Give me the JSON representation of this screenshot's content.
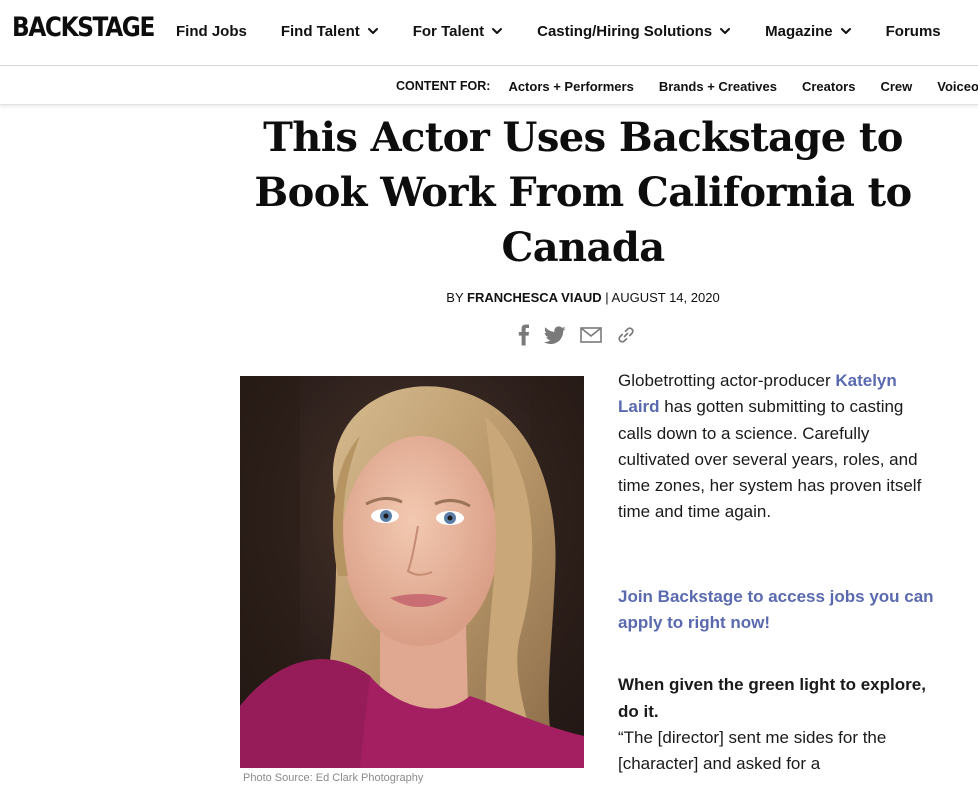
{
  "brand": {
    "logo": "BACKSTAGE"
  },
  "nav": {
    "items": [
      {
        "label": "Find Jobs",
        "dropdown": false
      },
      {
        "label": "Find Talent",
        "dropdown": true
      },
      {
        "label": "For Talent",
        "dropdown": true
      },
      {
        "label": "Casting/Hiring Solutions",
        "dropdown": true
      },
      {
        "label": "Magazine",
        "dropdown": true
      },
      {
        "label": "Forums",
        "dropdown": false
      }
    ]
  },
  "subnav": {
    "label": "CONTENT FOR:",
    "items": [
      "Actors + Performers",
      "Brands + Creatives",
      "Creators",
      "Crew",
      "Voiceo"
    ]
  },
  "article": {
    "headline_lines": [
      "This Actor Uses Backstage to",
      "Book Work From California to",
      "Canada"
    ],
    "byline_prefix": "BY",
    "author": "FRANCHESCA VIAUD",
    "separator": "|",
    "date": "AUGUST 14, 2020",
    "share_icons": [
      "facebook-icon",
      "twitter-icon",
      "email-icon",
      "link-icon"
    ],
    "photo_caption": "Photo Source: Ed Clark Photography",
    "intro_before": "Globetrotting actor-producer",
    "intro_link": "Katelyn Laird",
    "intro_after": "has gotten submitting to casting calls down to a science. Carefully cultivated over several years, roles, and time zones, her system has proven itself time and time again.",
    "cta_link": "Join Backstage to access jobs you can apply to right now!",
    "subheading": "When given the green light to explore, do it.",
    "quote_start": "“The [director] sent me sides for the [character] and asked for a"
  },
  "colors": {
    "link": "#5a6aaf",
    "text": "#111111",
    "caption": "#8a8a8a"
  }
}
